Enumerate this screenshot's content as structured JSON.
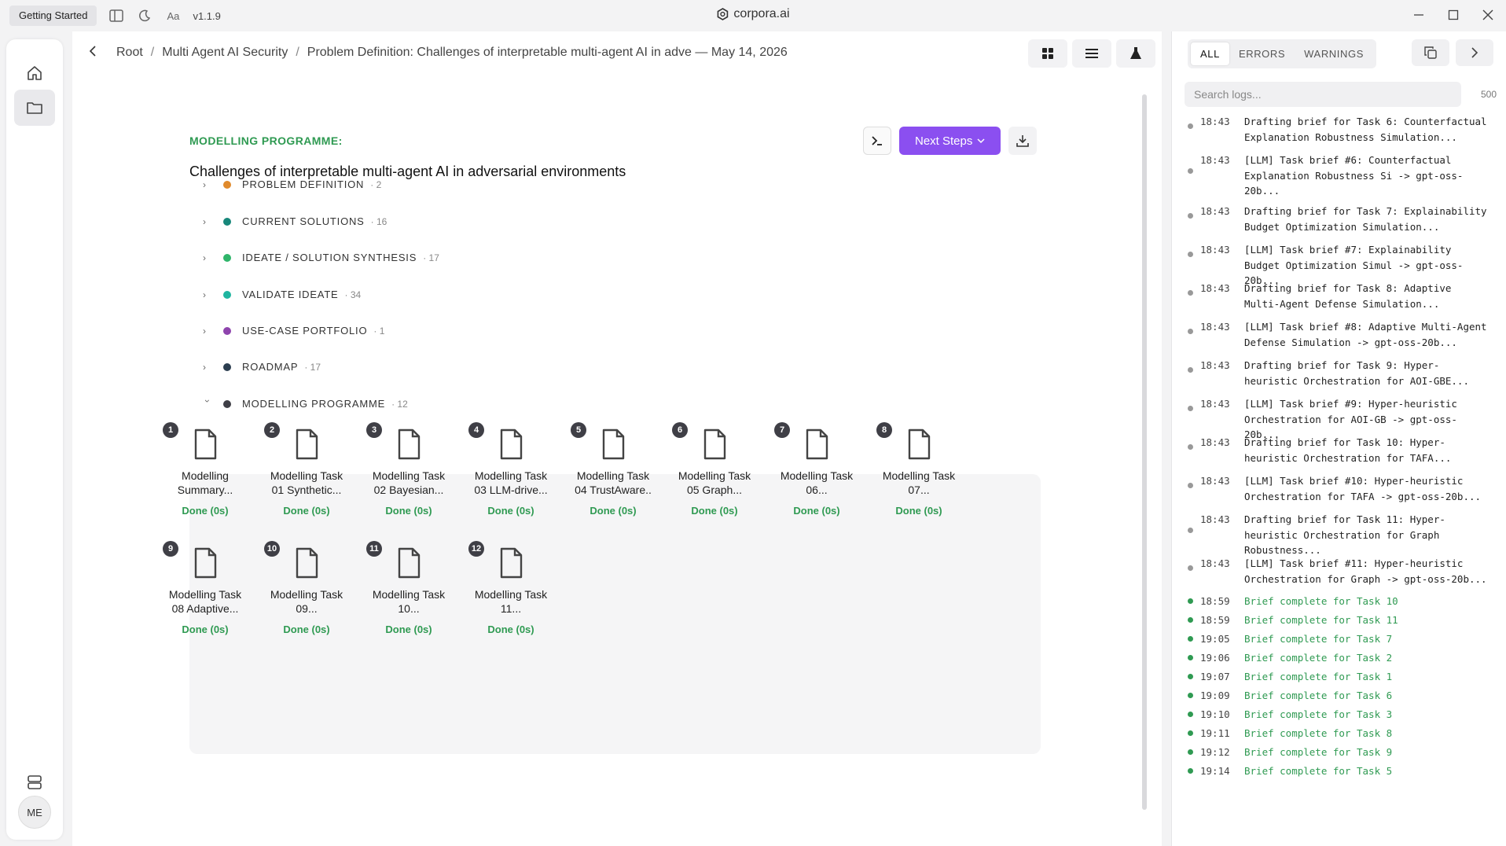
{
  "titlebar": {
    "getting_started": "Getting Started",
    "version": "v1.1.9",
    "app_title": "corpora.ai"
  },
  "rail": {
    "avatar_initials": "ME"
  },
  "breadcrumb": {
    "root": "Root",
    "project": "Multi Agent AI Security",
    "current": "Problem Definition: Challenges of interpretable multi-agent AI in adve — May 14, 2026"
  },
  "header": {
    "section_label": "MODELLING PROGRAMME:",
    "title": "Challenges of interpretable multi-agent AI in adversarial environments",
    "next_steps": "Next Steps"
  },
  "categories": [
    {
      "label": "PROBLEM DEFINITION",
      "count": "· 2",
      "color": "#e08a2c"
    },
    {
      "label": "CURRENT SOLUTIONS",
      "count": "· 16",
      "color": "#17877a"
    },
    {
      "label": "IDEATE / SOLUTION SYNTHESIS",
      "count": "· 17",
      "color": "#2fb56a"
    },
    {
      "label": "VALIDATE IDEATE",
      "count": "· 34",
      "color": "#1fb5a0"
    },
    {
      "label": "USE-CASE PORTFOLIO",
      "count": "· 1",
      "color": "#8e44ad"
    },
    {
      "label": "ROADMAP",
      "count": "· 17",
      "color": "#2c3e50"
    },
    {
      "label": "MODELLING PROGRAMME",
      "count": "· 12",
      "color": "#3f3f46"
    }
  ],
  "tasks": [
    {
      "num": "1",
      "line1": "Modelling",
      "line2": "Summary...",
      "status": "Done (0s)"
    },
    {
      "num": "2",
      "line1": "Modelling Task",
      "line2": "01 Synthetic...",
      "status": "Done (0s)"
    },
    {
      "num": "3",
      "line1": "Modelling Task",
      "line2": "02 Bayesian...",
      "status": "Done (0s)"
    },
    {
      "num": "4",
      "line1": "Modelling Task",
      "line2": "03 LLM-drive...",
      "status": "Done (0s)"
    },
    {
      "num": "5",
      "line1": "Modelling Task",
      "line2": "04 TrustAware..",
      "status": "Done (0s)"
    },
    {
      "num": "6",
      "line1": "Modelling Task",
      "line2": "05 Graph...",
      "status": "Done (0s)"
    },
    {
      "num": "7",
      "line1": "Modelling Task",
      "line2": "06...",
      "status": "Done (0s)"
    },
    {
      "num": "8",
      "line1": "Modelling Task",
      "line2": "07...",
      "status": "Done (0s)"
    },
    {
      "num": "9",
      "line1": "Modelling Task",
      "line2": "08 Adaptive...",
      "status": "Done (0s)"
    },
    {
      "num": "10",
      "line1": "Modelling Task",
      "line2": "09...",
      "status": "Done (0s)"
    },
    {
      "num": "11",
      "line1": "Modelling Task",
      "line2": "10...",
      "status": "Done (0s)"
    },
    {
      "num": "12",
      "line1": "Modelling Task",
      "line2": "11...",
      "status": "Done (0s)"
    }
  ],
  "logs": {
    "tabs": [
      "ALL",
      "ERRORS",
      "WARNINGS"
    ],
    "search_placeholder": "Search logs...",
    "count": "500",
    "entries": [
      {
        "time": "18:43",
        "msg": "Drafting brief for Task 6: Counterfactual Explanation Robustness Simulation...",
        "ok": false
      },
      {
        "time": "18:43",
        "msg": "[LLM] Task brief #6: Counterfactual Explanation Robustness Si -> gpt-oss-20b...",
        "ok": false
      },
      {
        "time": "18:43",
        "msg": "Drafting brief for Task 7: Explainability Budget Optimization Simulation...",
        "ok": false
      },
      {
        "time": "18:43",
        "msg": "[LLM] Task brief #7: Explainability Budget Optimization Simul -> gpt-oss-20b...",
        "ok": false
      },
      {
        "time": "18:43",
        "msg": "Drafting brief for Task 8: Adaptive Multi-Agent Defense Simulation...",
        "ok": false
      },
      {
        "time": "18:43",
        "msg": "[LLM] Task brief #8: Adaptive Multi-Agent Defense Simulation -> gpt-oss-20b...",
        "ok": false
      },
      {
        "time": "18:43",
        "msg": "Drafting brief for Task 9: Hyper-heuristic Orchestration for AOI-GBE...",
        "ok": false
      },
      {
        "time": "18:43",
        "msg": "[LLM] Task brief #9: Hyper-heuristic Orchestration for AOI-GB -> gpt-oss-20b...",
        "ok": false
      },
      {
        "time": "18:43",
        "msg": "Drafting brief for Task 10: Hyper-heuristic Orchestration for TAFA...",
        "ok": false
      },
      {
        "time": "18:43",
        "msg": "[LLM] Task brief #10: Hyper-heuristic Orchestration for TAFA -> gpt-oss-20b...",
        "ok": false
      },
      {
        "time": "18:43",
        "msg": "Drafting brief for Task 11: Hyper-heuristic Orchestration for Graph Robustness...",
        "ok": false
      },
      {
        "time": "18:43",
        "msg": "[LLM] Task brief #11: Hyper-heuristic Orchestration for Graph -> gpt-oss-20b...",
        "ok": false
      },
      {
        "time": "18:59",
        "msg": "Brief complete for Task 10",
        "ok": true
      },
      {
        "time": "18:59",
        "msg": "Brief complete for Task 11",
        "ok": true
      },
      {
        "time": "19:05",
        "msg": "Brief complete for Task 7",
        "ok": true
      },
      {
        "time": "19:06",
        "msg": "Brief complete for Task 2",
        "ok": true
      },
      {
        "time": "19:07",
        "msg": "Brief complete for Task 1",
        "ok": true
      },
      {
        "time": "19:09",
        "msg": "Brief complete for Task 6",
        "ok": true
      },
      {
        "time": "19:10",
        "msg": "Brief complete for Task 3",
        "ok": true
      },
      {
        "time": "19:11",
        "msg": "Brief complete for Task 8",
        "ok": true
      },
      {
        "time": "19:12",
        "msg": "Brief complete for Task 9",
        "ok": true
      },
      {
        "time": "19:14",
        "msg": "Brief complete for Task 5",
        "ok": true
      }
    ]
  },
  "colors": {
    "accent_purple": "#8b4ff0",
    "done_green": "#2f9a52"
  }
}
